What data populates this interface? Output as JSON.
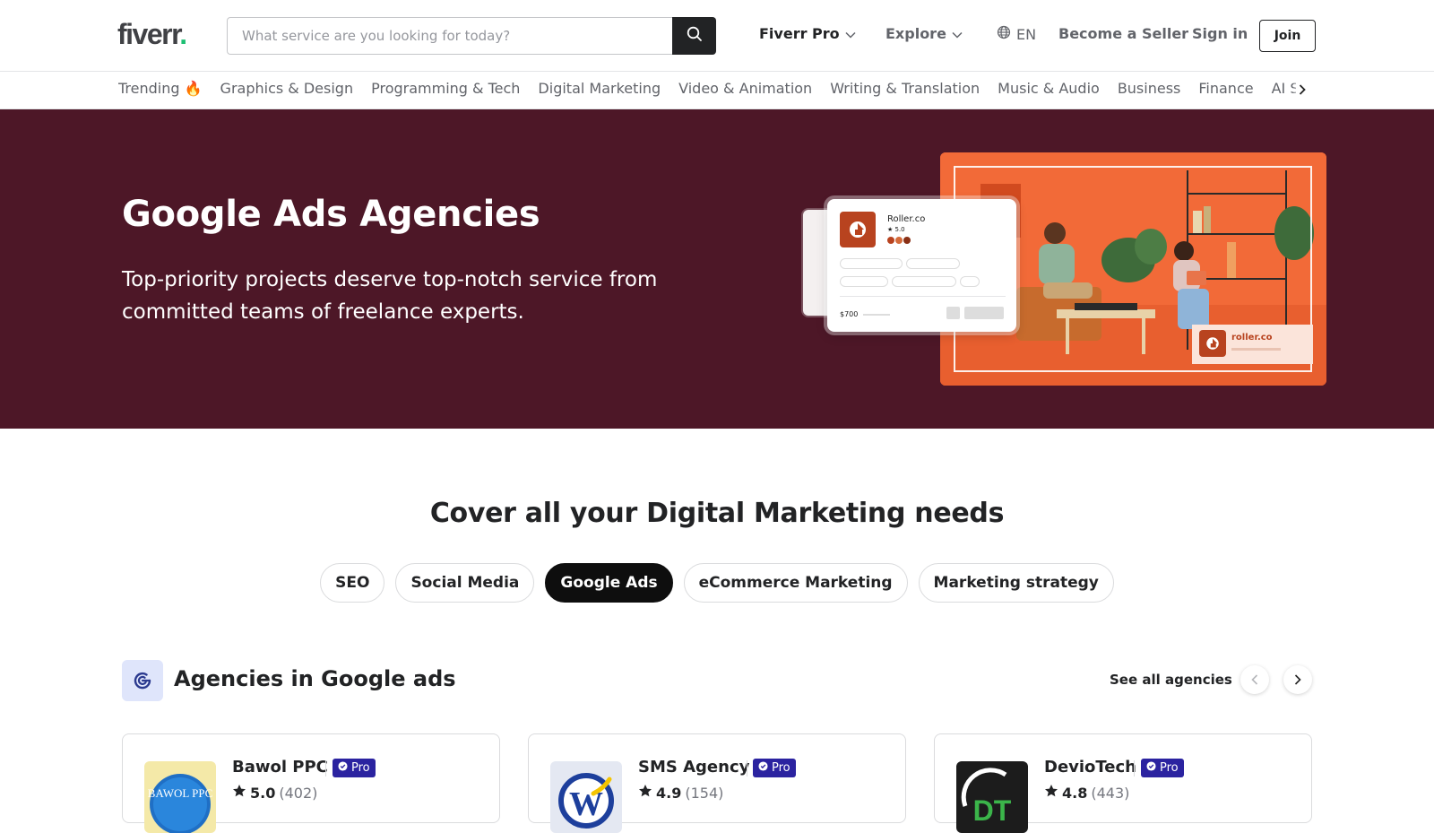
{
  "header": {
    "logo": "fiverr",
    "logo_dot": ".",
    "search_placeholder": "What service are you looking for today?",
    "search_icon": "search-icon",
    "fiverr_pro": "Fiverr Pro",
    "explore": "Explore",
    "language": "EN",
    "become_seller": "Become a Seller",
    "sign_in": "Sign in",
    "join": "Join"
  },
  "categories": [
    "Trending 🔥",
    "Graphics & Design",
    "Programming & Tech",
    "Digital Marketing",
    "Video & Animation",
    "Writing & Translation",
    "Music & Audio",
    "Business",
    "Finance",
    "AI Services"
  ],
  "hero": {
    "title": "Google Ads Agencies",
    "subtitle": "Top-priority projects deserve top-notch service from committed teams of freelance experts.",
    "mock_card": {
      "name": "Roller.co",
      "rating": "★ 5.0",
      "price": "$700"
    },
    "corner_badge": "roller.co"
  },
  "section": {
    "title": "Cover all your Digital Marketing needs",
    "chips": [
      {
        "label": "SEO",
        "active": false
      },
      {
        "label": "Social Media",
        "active": false
      },
      {
        "label": "Google Ads",
        "active": true
      },
      {
        "label": "eCommerce Marketing",
        "active": false
      },
      {
        "label": "Marketing strategy",
        "active": false
      }
    ]
  },
  "agencies": {
    "title": "Agencies in Google ads",
    "see_all": "See all agencies",
    "cards": [
      {
        "name": "Bawol PPC",
        "badge": "Pro",
        "rating": "5.0",
        "reviews": "(402)",
        "avatar_text": "BAWOL PPC"
      },
      {
        "name": "SMS Agency",
        "badge": "Pro",
        "rating": "4.9",
        "reviews": "(154)",
        "avatar_text": "W"
      },
      {
        "name": "DevioTech",
        "badge": "Pro",
        "rating": "4.8",
        "reviews": "(443)",
        "avatar_text": "DT"
      }
    ]
  },
  "colors": {
    "hero_bg": "#4d1727",
    "brand_green": "#1dbf73",
    "pro_badge": "#2b23a0",
    "hero_photo": "#f26a38"
  }
}
